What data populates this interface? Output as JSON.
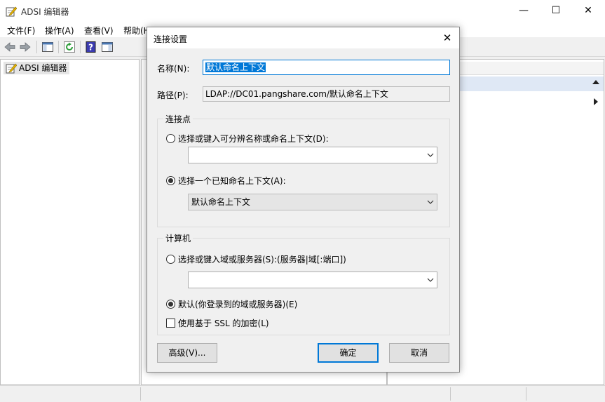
{
  "window": {
    "title": "ADSI 编辑器",
    "controls": {
      "minimize": "—",
      "maximize": "☐",
      "close": "✕"
    }
  },
  "menu": [
    "文件(F)",
    "操作(A)",
    "查看(V)",
    "帮助(H)"
  ],
  "toolbar": [
    "back-arrow-icon",
    "forward-arrow-icon",
    "show-hide-tree-icon",
    "refresh-icon",
    "help-icon",
    "show-hide-action-pane-icon"
  ],
  "tree": {
    "root": "ADSI 编辑器"
  },
  "dialog": {
    "title": "连接设置",
    "close": "✕",
    "name_label": "名称(N):",
    "name_value": "默认命名上下文",
    "path_label": "路径(P):",
    "path_value": "LDAP://DC01.pangshare.com/默认命名上下文",
    "connection_point": {
      "title": "连接点",
      "option_dn": "选择或键入可分辨名称或命名上下文(D):",
      "dn_value": "",
      "option_known": "选择一个已知命名上下文(A):",
      "known_value": "默认命名上下文",
      "selected": "known"
    },
    "computer": {
      "title": "计算机",
      "option_server": "选择或键入域或服务器(S):(服务器|域[:端口])",
      "server_value": "",
      "option_default": "默认(你登录到的域或服务器)(E)",
      "selected": "default",
      "ssl_label": "使用基于 SSL 的加密(L)",
      "ssl_checked": false
    },
    "buttons": {
      "advanced": "高级(V)...",
      "ok": "确定",
      "cancel": "取消"
    }
  },
  "colors": {
    "accent": "#0078d7",
    "selection": "#dfe8f5"
  }
}
